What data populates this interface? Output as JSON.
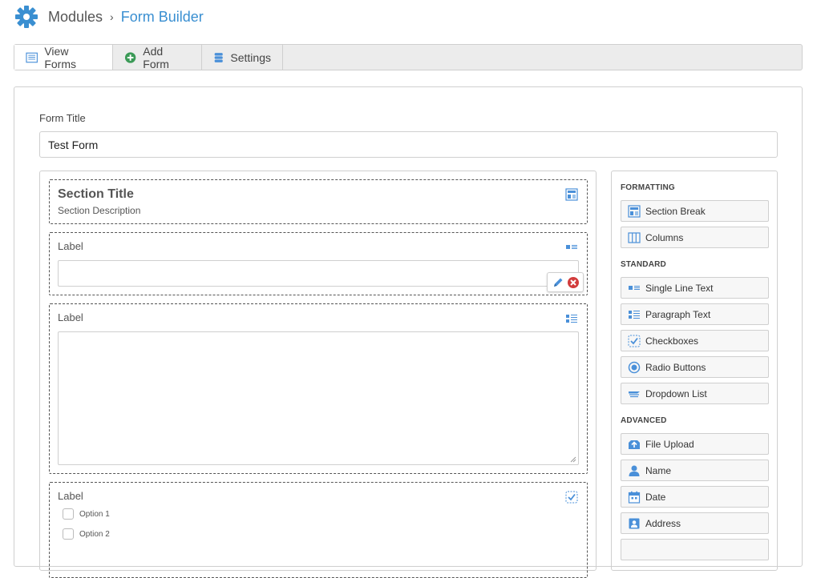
{
  "breadcrumb": {
    "root": "Modules",
    "separator": "›",
    "current": "Form Builder"
  },
  "tabs": [
    {
      "label": "View Forms",
      "icon": "list-icon",
      "active": true
    },
    {
      "label": "Add Form",
      "icon": "plus-circle-icon",
      "active": false
    },
    {
      "label": "Settings",
      "icon": "database-icon",
      "active": false
    }
  ],
  "form": {
    "title_label": "Form Title",
    "title_value": "Test Form"
  },
  "canvas": {
    "section": {
      "title": "Section Title",
      "description": "Section Description"
    },
    "single_line": {
      "label": "Label"
    },
    "paragraph": {
      "label": "Label"
    },
    "checkboxes": {
      "label": "Label",
      "options": [
        "Option 1",
        "Option 2"
      ]
    }
  },
  "palette": {
    "formatting_heading": "FORMATTING",
    "formatting": [
      {
        "label": "Section Break",
        "icon": "section-break-icon"
      },
      {
        "label": "Columns",
        "icon": "columns-icon"
      }
    ],
    "standard_heading": "STANDARD",
    "standard": [
      {
        "label": "Single Line Text",
        "icon": "single-line-icon"
      },
      {
        "label": "Paragraph Text",
        "icon": "paragraph-icon"
      },
      {
        "label": "Checkboxes",
        "icon": "checkbox-icon"
      },
      {
        "label": "Radio Buttons",
        "icon": "radio-icon"
      },
      {
        "label": "Dropdown List",
        "icon": "dropdown-icon"
      }
    ],
    "advanced_heading": "ADVANCED",
    "advanced": [
      {
        "label": "File Upload",
        "icon": "upload-icon"
      },
      {
        "label": "Name",
        "icon": "person-icon"
      },
      {
        "label": "Date",
        "icon": "calendar-icon"
      },
      {
        "label": "Address",
        "icon": "address-card-icon"
      }
    ]
  },
  "colors": {
    "accent": "#3a8fd1",
    "icon_blue": "#4a90d9",
    "green": "#3b9a57",
    "delete_red": "#d23c3c"
  }
}
